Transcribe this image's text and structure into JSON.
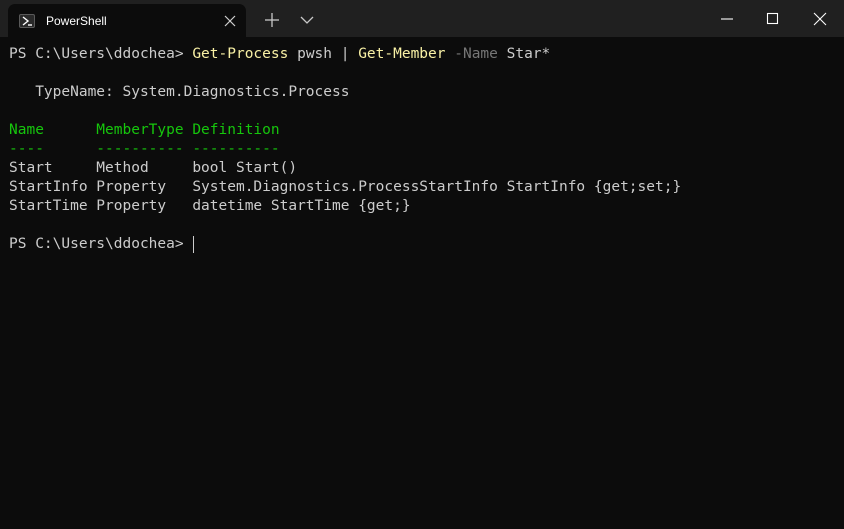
{
  "tab": {
    "title": "PowerShell",
    "icon": "powershell-icon"
  },
  "toolbar": {
    "new_tab_icon": "plus-icon",
    "dropdown_icon": "chevron-down-icon"
  },
  "window_controls": [
    "minimize-icon",
    "maximize-icon",
    "close-icon"
  ],
  "terminal": {
    "prompt1": "PS C:\\Users\\ddochea> ",
    "cmd_part1": "Get-Process",
    "cmd_part2": " pwsh | ",
    "cmd_part3": "Get-Member",
    "cmd_part4": " -Name",
    "cmd_part5": " Star*",
    "typename": "   TypeName: System.Diagnostics.Process",
    "header": "Name      MemberType Definition",
    "separator": "----      ---------- ----------",
    "rows": [
      "Start     Method     bool Start()",
      "StartInfo Property   System.Diagnostics.ProcessStartInfo StartInfo {get;set;}",
      "StartTime Property   datetime StartTime {get;}"
    ],
    "prompt2": "PS C:\\Users\\ddochea> "
  },
  "colors": {
    "background": "#0c0c0c",
    "titlebar": "#202020",
    "text": "#cccccc",
    "command": "#f9f1a5",
    "parameter": "#767676",
    "header": "#16c60c"
  }
}
